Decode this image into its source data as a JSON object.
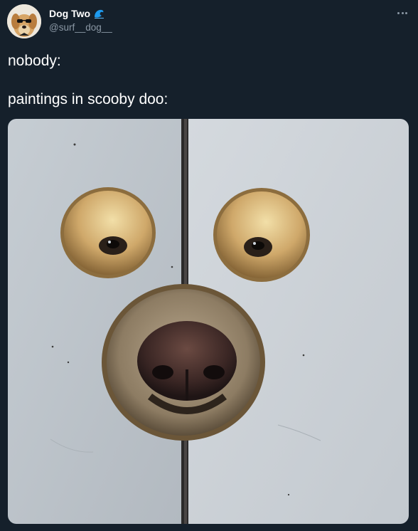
{
  "author": {
    "display_name": "Dog Two",
    "handle": "@surf__dog__",
    "avatar_icon": "dog-with-sunglasses-avatar",
    "badge_icon": "wave-emoji-icon"
  },
  "menu": {
    "icon": "more-options-icon"
  },
  "tweet": {
    "line1": "nobody:",
    "line2": "paintings in scooby doo:"
  },
  "media": {
    "icon": "dog-face-through-wall-photo"
  },
  "colors": {
    "background": "#15202b",
    "text_primary": "#ffffff",
    "text_secondary": "#8b98a5",
    "wave_blue": "#1d9bf0"
  }
}
